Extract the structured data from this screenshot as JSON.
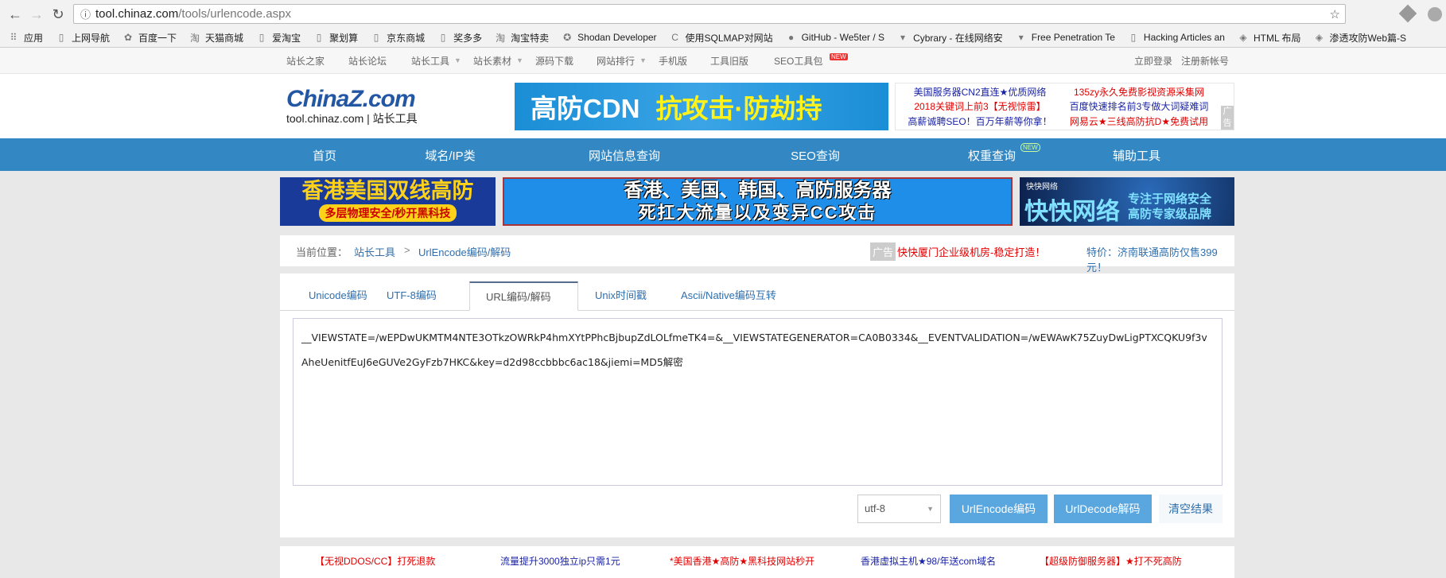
{
  "browser": {
    "url_host": "tool.chinaz.com",
    "url_path": "/tools/urlencode.aspx",
    "bookmarks": [
      "应用",
      "上网导航",
      "百度一下",
      "天猫商城",
      "爱淘宝",
      "聚划算",
      "京东商城",
      "奖多多",
      "淘宝特卖",
      "Shodan Developer",
      "使用SQLMAP对网站",
      "GitHub - We5ter / S",
      "Cybrary - 在线网络安",
      "Free Penetration Te",
      "Hacking Articles an",
      "HTML 布局",
      "渗透攻防Web篇-S"
    ]
  },
  "topnav": {
    "items": [
      "站长之家",
      "站长论坛",
      "站长工具",
      "站长素材",
      "源码下载",
      "网站排行",
      "手机版",
      "工具旧版",
      "SEO工具包"
    ],
    "new_badge": "NEW",
    "login": "立即登录",
    "register": "注册新帐号"
  },
  "header": {
    "logo_main": "ChinaZ.com",
    "logo_sub": "tool.chinaz.com | 站长工具",
    "banner_white": "高防CDN",
    "banner_yellow": "抗攻击·防劫持",
    "ad_label": "广告",
    "text_ads": [
      [
        "美国服务器CN2直连★优质网络",
        "135zy永久免费影视资源采集网"
      ],
      [
        "2018关键词上前3【无视惊雷】",
        "百度快速排名前3专做大词疑难词"
      ],
      [
        "高薪诚聘SEO！百万年薪等你拿！",
        "网易云★三线高防抗D★免费试用"
      ]
    ]
  },
  "mainnav": {
    "items": [
      "首页",
      "域名/IP类",
      "网站信息查询",
      "SEO查询",
      "权重查询",
      "辅助工具"
    ],
    "new_badge": "NEW"
  },
  "banners": {
    "b1_title": "香港美国双线高防",
    "b1_sub": "多层物理安全/秒开黑科技",
    "b2_line1": "香港、美国、韩国、高防服务器",
    "b2_line2": "死扛大流量以及变异CC攻击",
    "b3_brand": "快快网络",
    "b3_title": "快快网络",
    "b3_sub1": "专注于网络安全",
    "b3_sub2": "高防专家级品牌",
    "ad_label": "广告"
  },
  "breadcrumb": {
    "prefix": "当前位置：",
    "link1": "站长工具",
    "sep": ">",
    "current": "UrlEncode编码/解码",
    "ad_label": "广告",
    "ad1": "快快厦门企业级机房-稳定打造！",
    "ad2": "特价：济南联通高防仅售399元！"
  },
  "tool": {
    "tabs": [
      "Unicode编码",
      "UTF-8编码",
      "URL编码/解码",
      "Unix时间戳",
      "Ascii/Native编码互转"
    ],
    "active_tab": 2,
    "input_value": "__VIEWSTATE=/wEPDwUKMTM4NTE3OTkzOWRkP4hmXYtPPhcBjbupZdLOLfmeTK4=&__VIEWSTATEGENERATOR=CA0B0334&__EVENTVALIDATION=/wEWAwK75ZuyDwLigPTXCQKU9f3vAheUenitfEuJ6eGUVe2GyFzb7HKC&key=d2d98ccbbbc6ac18&jiemi=MD5解密",
    "charset": "utf-8",
    "encode_btn": "UrlEncode编码",
    "decode_btn": "UrlDecode解码",
    "clear_btn": "清空结果"
  },
  "footer_ads": [
    {
      "text": "【无视DDOS/CC】打死退款",
      "color": "#e10000"
    },
    {
      "text": "流量提升3000独立ip只需1元",
      "color": "#1a23a5"
    },
    {
      "text": "*美国香港★高防★黑科技网站秒开",
      "color": "#e10000"
    },
    {
      "text": "香港虚拟主机★98/年送com域名",
      "color": "#1a23a5"
    },
    {
      "text": "【超级防御服务器】★打不死高防",
      "color": "#e10000"
    }
  ],
  "colors": {
    "nav_blue": "#3388c4",
    "button_blue": "#5aa7e0",
    "link_blue": "#2f6fad"
  }
}
